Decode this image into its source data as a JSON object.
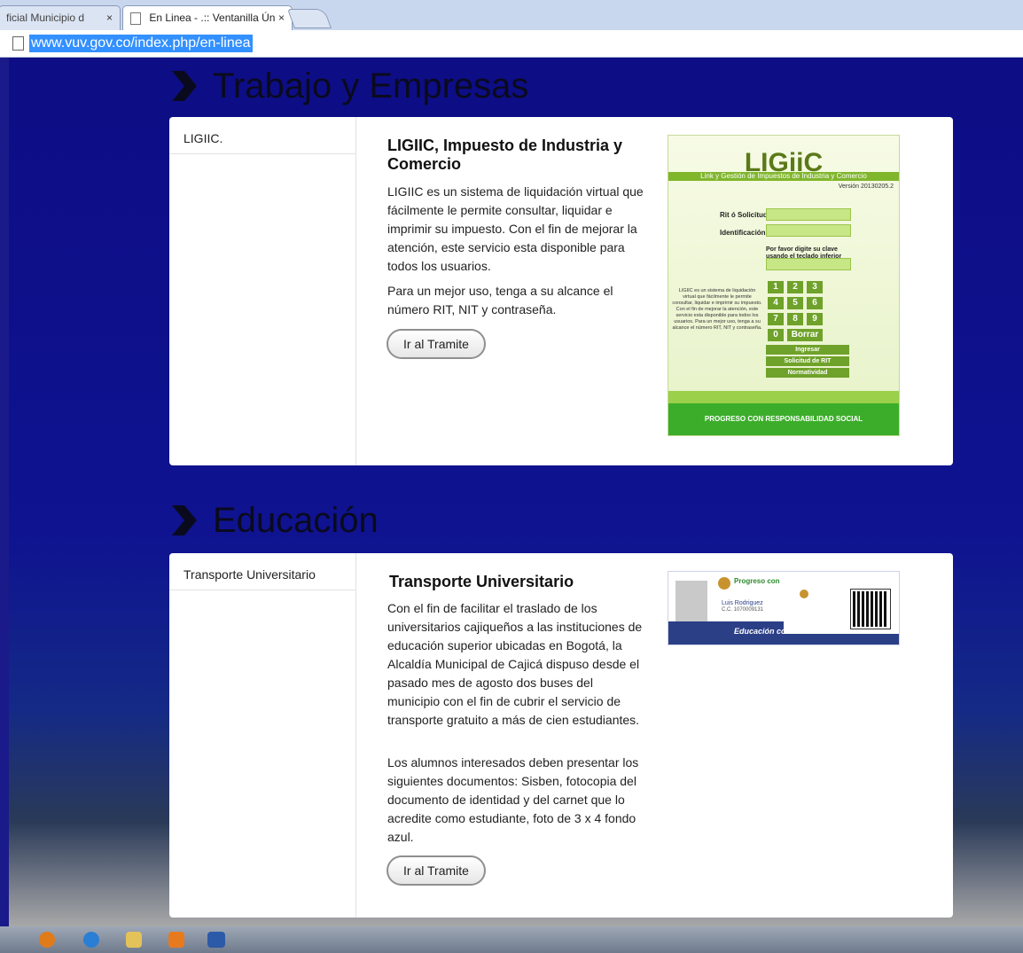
{
  "browser": {
    "tabs": [
      {
        "title": "ficial Municipio d",
        "close": "×"
      },
      {
        "title": "En Linea - .:: Ventanilla Ún",
        "close": "×"
      }
    ],
    "url": "www.vuv.gov.co/index.php/en-linea"
  },
  "sections": [
    {
      "title": "Trabajo y Empresas",
      "sidebar_item": "LIGIIC.",
      "heading": "LIGIIC, Impuesto de Industria y Comercio",
      "paragraphs": [
        "LIGIIC es un sistema de liquidación virtual que fácilmente le permite consultar, liquidar e imprimir su impuesto. Con el fin de mejorar la atención, este servicio esta disponible para todos los usuarios.",
        "Para un mejor uso, tenga a su alcance el número RIT, NIT y contraseña."
      ],
      "button": "Ir al Tramite",
      "thumbnail": {
        "logo": "LIGiiC",
        "subtitle": "Link y Gestión de Impuestos de Industria y Comercio",
        "version": "Versión 20130205.2",
        "rit_label": "Rit ó Solicitud:",
        "id_label": "Identificación:",
        "keyboard_hint": "Por favor digite su clave usando el teclado inferior",
        "description": "LIGIIC es un sistema de liquidación virtual que fácilmente le permite consultar, liquidar e imprimir su impuesto. Con el fin de mejorar la atención, este servicio esta disponible para todos los usuarios. Para un mejor uso, tenga a su alcance el número RIT, NIT y contraseña.",
        "keys": [
          "1",
          "2",
          "3",
          "4",
          "5",
          "6",
          "7",
          "8",
          "9",
          "0"
        ],
        "borrar": "Borrar",
        "ingresar": "Ingresar",
        "solicitud": "Solicitud de RIT",
        "normatividad": "Normatividad",
        "footer": "PROGRESO CON RESPONSABILIDAD SOCIAL"
      }
    },
    {
      "title": "Educación",
      "sidebar_item": "Transporte Universitario",
      "heading": "Transporte Universitario",
      "paragraphs": [
        "Con el fin de facilitar el traslado de los universitarios cajiqueños a las instituciones de educación superior ubicadas en Bogotá, la Alcaldía Municipal de Cajicá dispuso desde el pasado mes de agosto dos buses del municipio con el fin de cubrir el servicio de transporte gratuito a más de cien estudiantes.",
        "Los alumnos interesados deben presentar los siguientes documentos: Sisben, fotocopia del documento de identidad y del carnet que lo acredite como estudiante, foto de 3 x 4 fondo azul."
      ],
      "button": "Ir al Tramite",
      "thumbnail": {
        "progreso": "Progreso con",
        "name": "Luis Rodriguez",
        "cc": "C.C. 1070009131",
        "educacion": "Educación con"
      }
    }
  ],
  "colors": {
    "page_background": "#0d0d85",
    "card_background": "#ffffff",
    "title_color": "#0a0a1e",
    "ligiic_green": "#6fa22a"
  },
  "icons": {
    "section_marker": "chevron-right-icon",
    "page": "page-icon",
    "taskbar": [
      "firefox-icon",
      "ie-icon",
      "explorer-icon",
      "outlook-icon",
      "word-icon"
    ]
  }
}
